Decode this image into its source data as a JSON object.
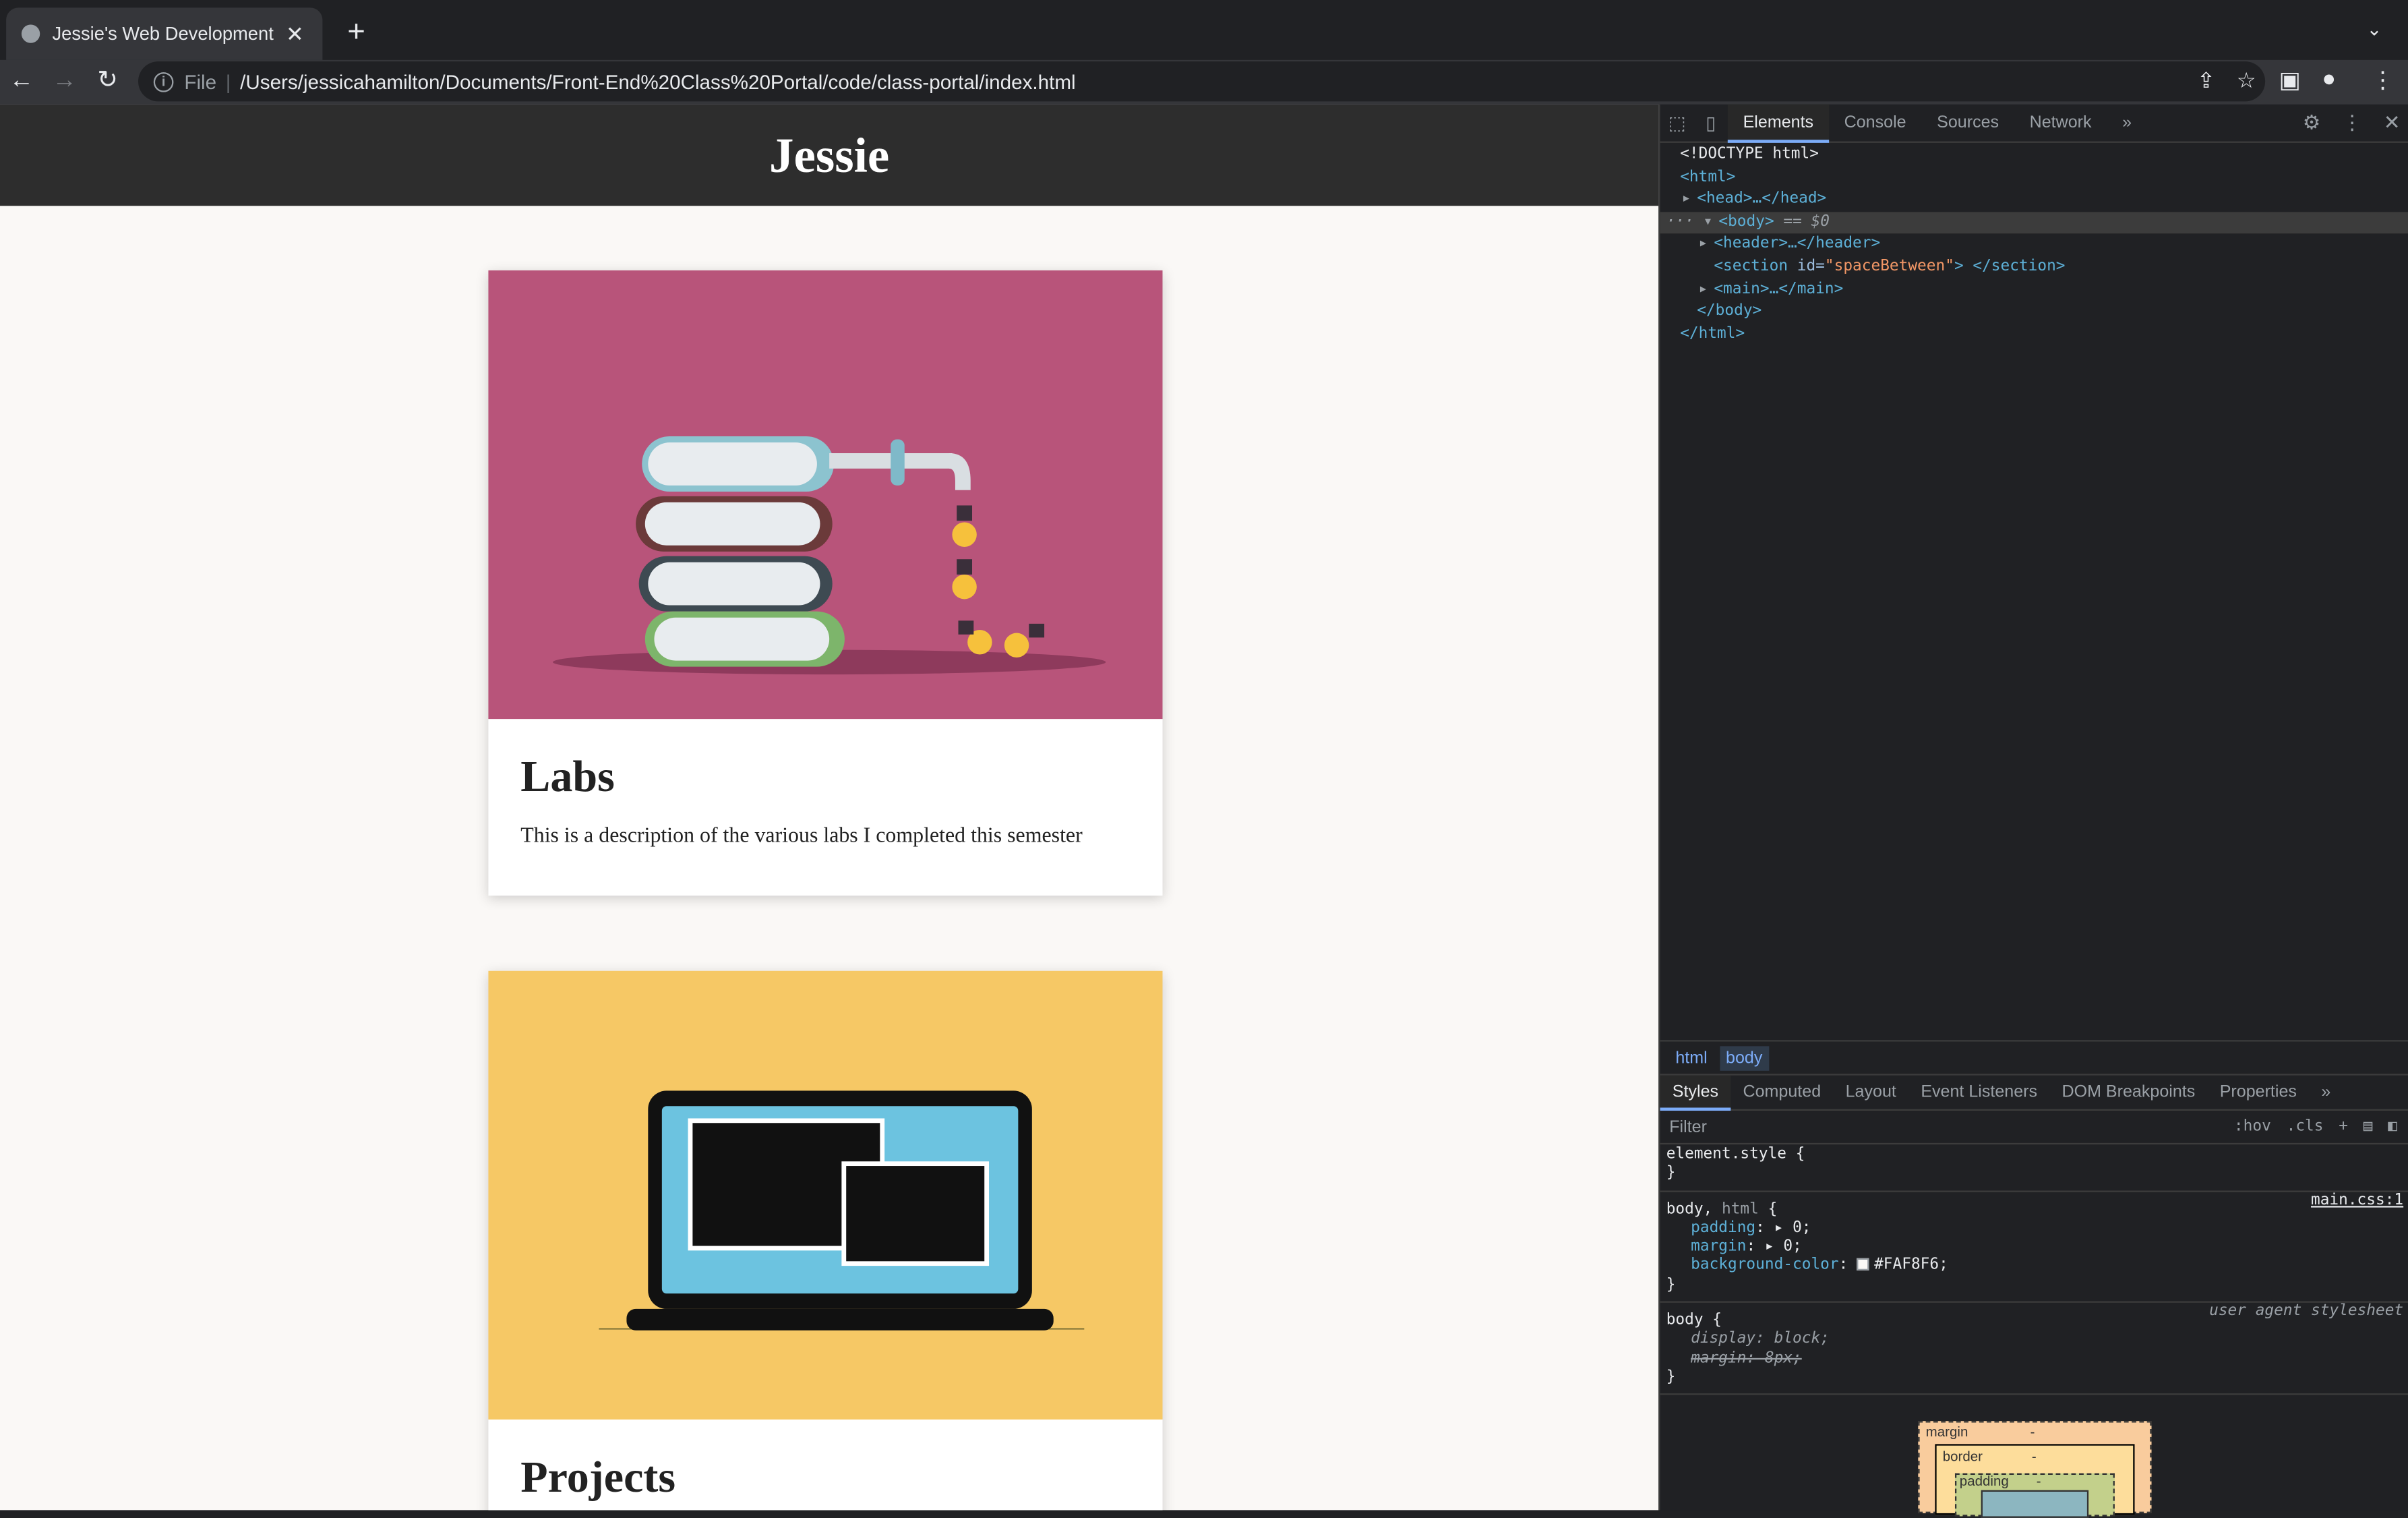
{
  "browser": {
    "tab_title": "Jessie's Web Development",
    "new_tab_label": "+",
    "omnibox_scheme": "File",
    "omnibox_url": "/Users/jessicahamilton/Documents/Front-End%20Class%20Portal/code/class-portal/index.html"
  },
  "site": {
    "header_title": "Jessie",
    "cards": [
      {
        "title": "Labs",
        "description": "This is a description of the various labs I completed this semester"
      },
      {
        "title": "Projects"
      }
    ]
  },
  "devtools": {
    "tabs": [
      "Elements",
      "Console",
      "Sources",
      "Network"
    ],
    "more": "»",
    "dom": {
      "doctype": "<!DOCTYPE html>",
      "html_open": "<html>",
      "head": "<head>…</head>",
      "body_open": "<body>",
      "body_marker": "== $0",
      "header": "<header>…</header>",
      "section_open": "<section ",
      "section_attr": "id=",
      "section_val": "\"spaceBetween\"",
      "section_close": "> </section>",
      "main": "<main>…</main>",
      "body_close": "</body>",
      "html_close": "</html>"
    },
    "breadcrumbs": [
      "html",
      "body"
    ],
    "styles_tabs": [
      "Styles",
      "Computed",
      "Layout",
      "Event Listeners",
      "DOM Breakpoints",
      "Properties"
    ],
    "filter_placeholder": "Filter",
    "filter_hov": ":hov",
    "filter_cls": ".cls",
    "rules": {
      "element_style": "element.style {",
      "close": "}",
      "body_html_selector": "body, ",
      "body_html_selector_dim": "html",
      "body_html_open": " {",
      "body_html_source": "main.css:1",
      "padding_name": "padding",
      "padding_val": "0;",
      "margin_name": "margin",
      "margin_val": "0;",
      "bg_name": "background-color",
      "bg_val": "#FAF8F6;",
      "body_selector": "body {",
      "ua_source": "user agent stylesheet",
      "display_name": "display",
      "display_val": "block;",
      "margin_ua": "margin: 8px;"
    },
    "boxmodel": {
      "margin_label": "margin",
      "border_label": "border",
      "padding_label": "padding",
      "dash": "-"
    }
  },
  "colors": {
    "page_bg": "#FAF8F6",
    "header_bg": "#2d2d2d",
    "labs_bg": "#b8547a",
    "projects_bg": "#f6c865"
  }
}
